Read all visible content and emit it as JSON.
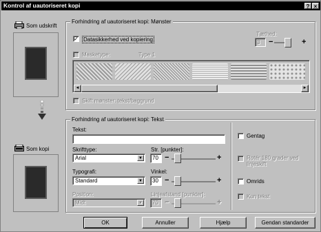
{
  "window": {
    "title": "Kontrol af uautoriseret kopi",
    "help_glyph": "?",
    "close_glyph": "×"
  },
  "left": {
    "original_label": "Som udskrift",
    "copy_label": "Som kopi"
  },
  "pattern_group": {
    "title": "Forhindring af uautoriseret kopi: Mønster",
    "security_checkbox_label": "Datasikkerhed ved kopiering",
    "security_checked": true,
    "density_label": "Tæthed:",
    "density_value": "3",
    "masktype_label": "Masketype:",
    "masktype_value": "Type 1",
    "hide_pattern_label": "Skift mønster: tekst/baggrund"
  },
  "text_group": {
    "title": "Forhindring af uautoriseret kopi: Tekst",
    "text_label": "Tekst:",
    "text_value": "",
    "font_label": "Skrifttype:",
    "font_value": "Arial",
    "size_label": "Str. [punkter]:",
    "size_value": "70",
    "typography_label": "Typografi:",
    "typography_value": "Standard",
    "angle_label": "Vinkel:",
    "angle_value": "30",
    "position_label": "Position:",
    "position_value": "Midt",
    "linespacing_label": "Linjeafstand [punkter]:",
    "linespacing_value": "70",
    "repeat_label": "Gentag",
    "rotate_label": "Rotér 180 grader ved linjeskift",
    "outline_label": "Omrids",
    "textonly_label": "Kun tekst"
  },
  "buttons": {
    "ok": "OK",
    "cancel": "Annuller",
    "help": "Hjælp",
    "defaults": "Gendan standarder"
  },
  "glyphs": {
    "minus": "−",
    "plus": "+",
    "dropdown": "▼",
    "scroll_left": "◄",
    "scroll_right": "►",
    "check": "✓"
  },
  "icons": {
    "printer": "printer-icon",
    "scanner": "scanner-icon",
    "arrow_down": "arrow-down-icon"
  }
}
